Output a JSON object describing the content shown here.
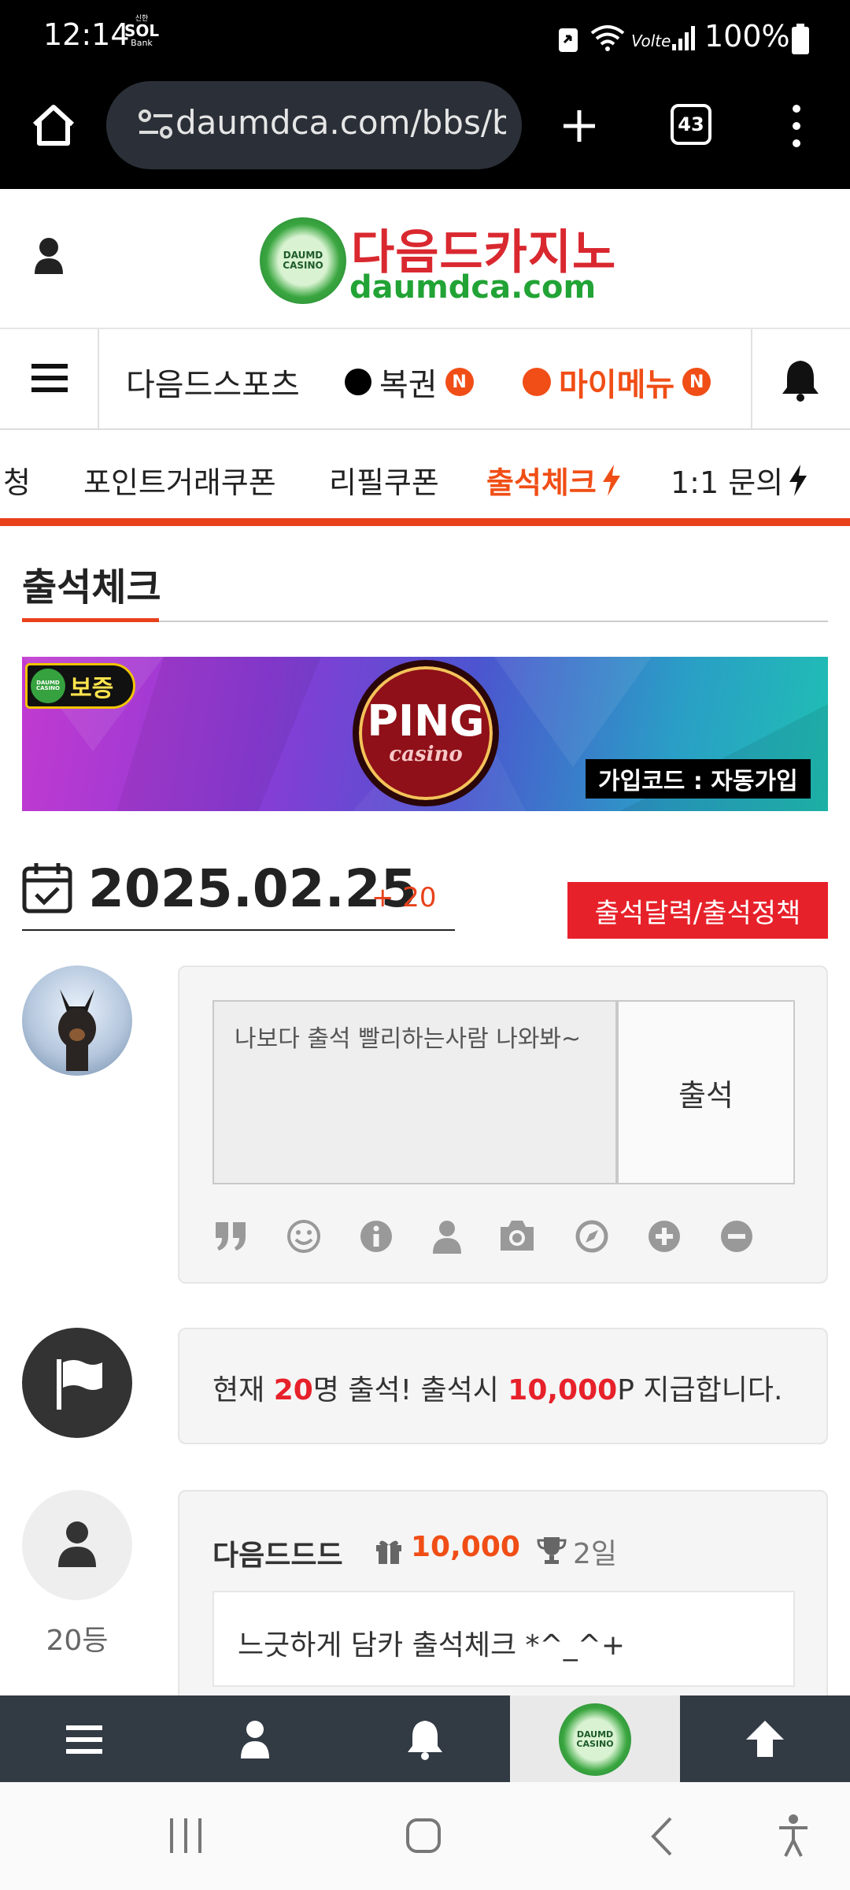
{
  "status": {
    "time": "12:14",
    "bank_label_top": "신한",
    "bank_label_mid": "SOL",
    "bank_label_bottom": "Bank",
    "volte": "Volte",
    "battery": "100%"
  },
  "browser": {
    "url": "daumdca.com/bbs/b",
    "tab_count": "43"
  },
  "site": {
    "logo_title": "다음드카지노",
    "logo_domain": "daumdca.com",
    "logo_badge_top": "DAUMD",
    "logo_badge_bottom": "CASINO"
  },
  "nav1": {
    "sports": "다음드스포츠",
    "lottery": "복권",
    "mymenu": "마이메뉴",
    "badge": "N"
  },
  "nav2": {
    "items": [
      "청",
      "포인트거래쿠폰",
      "리필쿠폰",
      "출석체크",
      "1:1 문의"
    ]
  },
  "page": {
    "title": "출석체크"
  },
  "banner": {
    "guarantee": "보증",
    "brand": "PING",
    "brand_sub": "casino",
    "code_label": "가입코드 : 자동가입",
    "badge_top": "DAUMD",
    "badge_bottom": "CASINO"
  },
  "attendance": {
    "date": "2025.02.25",
    "plus": "+ 20",
    "calendar_button": "출석달력/출석정책",
    "comment_placeholder": "나보다 출석 빨리하는사람 나와봐~",
    "submit": "출석"
  },
  "notice": {
    "prefix": "현재 ",
    "count": "20",
    "mid": "명 출석! 출석시 ",
    "points": "10,000",
    "suffix": "P 지급합니다."
  },
  "entry": {
    "rank": "20등",
    "username": "다음드드드",
    "reward": "10,000",
    "days": "2일",
    "message": "느긋하게 담카 출석체크 *^_^+"
  },
  "bottom_bar": {
    "logo_top": "DAUMD",
    "logo_bottom": "CASINO"
  },
  "colors": {
    "accent_orange": "#f04e16",
    "accent_red": "#e7212a",
    "chrome": "#000000",
    "tabbar": "#323a44"
  }
}
